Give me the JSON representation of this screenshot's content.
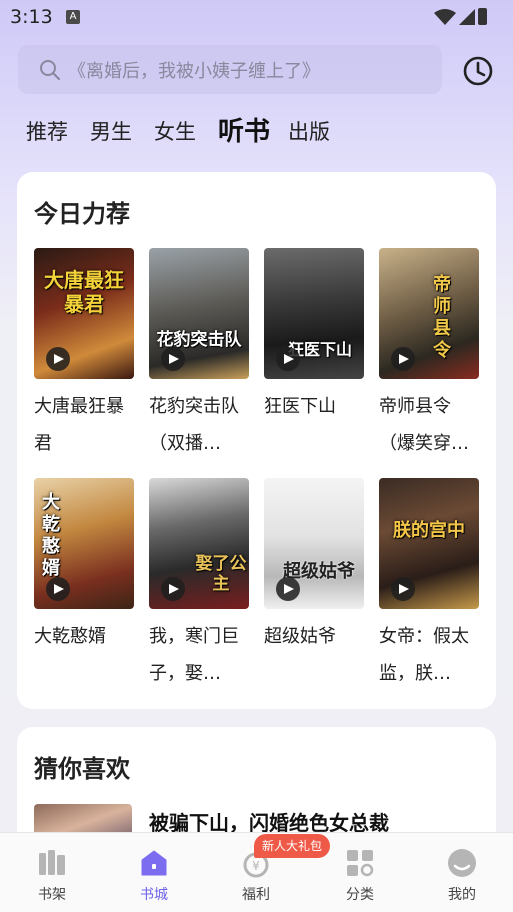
{
  "status": {
    "time": "3:13",
    "notification_glyph": "A"
  },
  "search": {
    "placeholder": "《离婚后，我被小姨子缠上了》"
  },
  "tabs": [
    {
      "label": "推荐",
      "active": false
    },
    {
      "label": "男生",
      "active": false
    },
    {
      "label": "女生",
      "active": false
    },
    {
      "label": "听书",
      "active": true
    },
    {
      "label": "出版",
      "active": false
    }
  ],
  "recommend": {
    "title": "今日力荐",
    "books": [
      {
        "name": "大唐最狂暴君",
        "cover_text": "大唐最狂暴君"
      },
      {
        "name": "花豹突击队（双播…",
        "cover_text": "花豹突击队"
      },
      {
        "name": "狂医下山",
        "cover_text": "狂医下山"
      },
      {
        "name": "帝师县令（爆笑穿…",
        "cover_text": "帝师县令"
      },
      {
        "name": "大乾憨婿",
        "cover_text": "大乾憨婿"
      },
      {
        "name": "我，寒门巨子，娶…",
        "cover_text": "娶了公主"
      },
      {
        "name": "超级姑爷",
        "cover_text": "超级姑爷"
      },
      {
        "name": "女帝：假太监，朕…",
        "cover_text": "朕的宫中"
      }
    ]
  },
  "guess": {
    "title": "猜你喜欢",
    "first_title": "被骗下山，闪婚绝色女总裁"
  },
  "bottom_nav": {
    "items": [
      {
        "label": "书架",
        "icon": "bookshelf-icon"
      },
      {
        "label": "书城",
        "icon": "bookstore-icon"
      },
      {
        "label": "福利",
        "icon": "welfare-icon"
      },
      {
        "label": "分类",
        "icon": "category-icon"
      },
      {
        "label": "我的",
        "icon": "profile-icon"
      }
    ],
    "gift_badge": "新人大礼包"
  },
  "colors": {
    "accent": "#6f62ea",
    "badge": "#ef5a48"
  }
}
